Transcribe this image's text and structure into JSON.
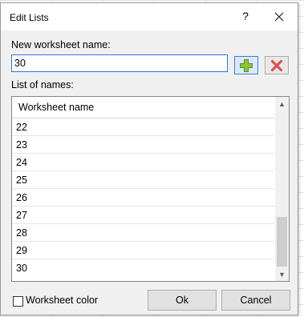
{
  "dialog": {
    "title": "Edit Lists",
    "help_label": "?"
  },
  "name_field": {
    "label": "New worksheet name:",
    "value": "30"
  },
  "list": {
    "label": "List of names:",
    "header": "Worksheet name",
    "items": [
      "22",
      "23",
      "24",
      "25",
      "26",
      "27",
      "28",
      "29",
      "30"
    ]
  },
  "scrollbar": {
    "position_fraction": 0.85
  },
  "footer": {
    "checkbox_label": "Worksheet color",
    "checkbox_checked": false,
    "ok_label": "Ok",
    "cancel_label": "Cancel"
  },
  "icons": {
    "add": "plus-icon",
    "delete": "delete-x-icon",
    "close": "close-icon"
  },
  "colors": {
    "add_green": "#8cc63e",
    "delete_red": "#d9534f",
    "focus_blue": "#2a7bd4"
  }
}
